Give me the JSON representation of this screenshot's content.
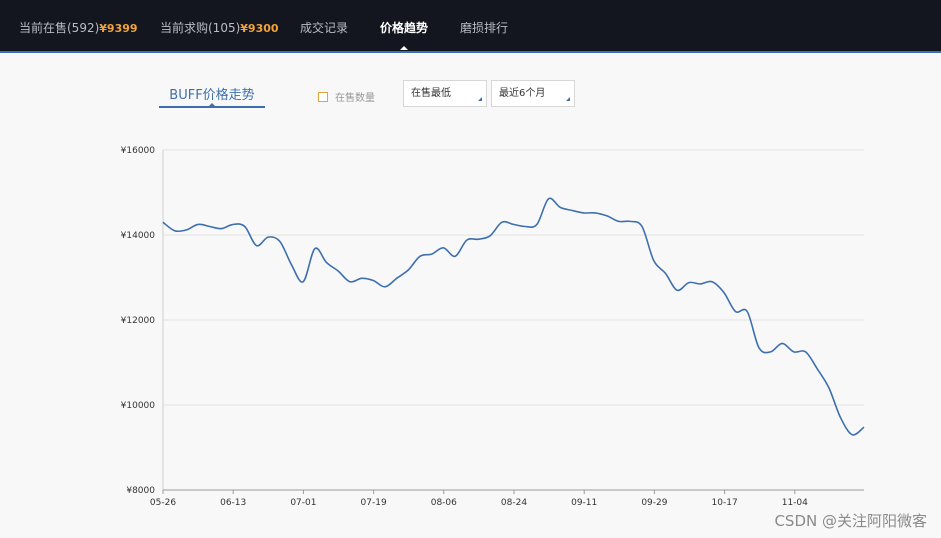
{
  "nav": {
    "tabs": [
      {
        "label": "当前在售(592)",
        "price": "¥9399"
      },
      {
        "label": "当前求购(105)",
        "price": "¥9300"
      },
      {
        "label": "成交记录"
      },
      {
        "label": "价格趋势"
      },
      {
        "label": "磨损排行"
      }
    ]
  },
  "chart_header": {
    "title": "BUFF价格走势",
    "checkbox_label": "在售数量",
    "select_price": "在售最低",
    "select_range": "最近6个月"
  },
  "colors": {
    "line": "#3d6fae",
    "accent": "#f0a43a",
    "nav_bg": "#14161f"
  },
  "chart_data": {
    "type": "line",
    "ylim": [
      8000,
      16000
    ],
    "y_ticks": [
      "¥16000",
      "¥14000",
      "¥12000",
      "¥10000",
      "¥8000"
    ],
    "x_ticks": [
      "05-26",
      "06-13",
      "07-01",
      "07-19",
      "08-06",
      "08-24",
      "09-11",
      "09-29",
      "10-17",
      "11-04"
    ],
    "series": [
      {
        "values": [
          14300,
          14100,
          14120,
          14250,
          14200,
          14150,
          14250,
          14200,
          13750,
          13950,
          13850,
          13300,
          12900,
          13680,
          13350,
          13150,
          12900,
          12980,
          12930,
          12780,
          12980,
          13180,
          13500,
          13550,
          13700,
          13500,
          13880,
          13900,
          13980,
          14300,
          14250,
          14200,
          14250,
          14850,
          14650,
          14580,
          14520,
          14520,
          14450,
          14320,
          14320,
          14200,
          13400,
          13100,
          12700,
          12880,
          12850,
          12900,
          12650,
          12200,
          12200,
          11350,
          11250,
          11450,
          11250,
          11250,
          10850,
          10400,
          9700,
          9300,
          9480
        ]
      }
    ]
  },
  "watermark": "CSDN @关注阿阳微客"
}
